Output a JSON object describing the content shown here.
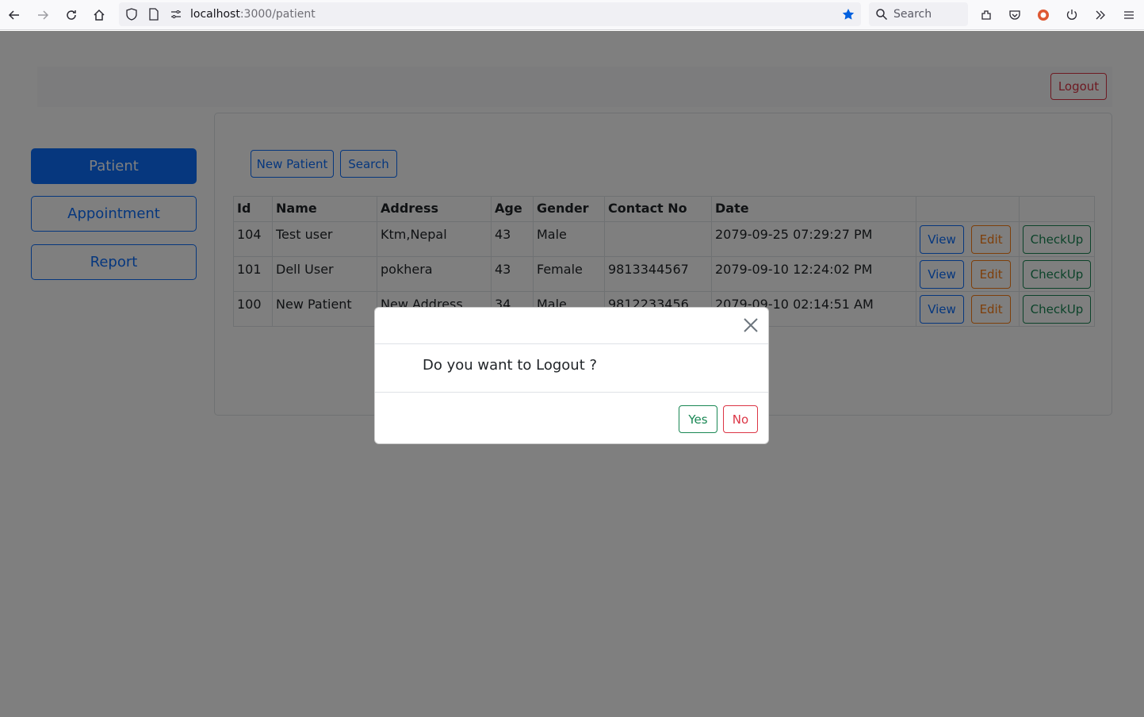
{
  "browser": {
    "url_host": "localhost",
    "url_path": ":3000/patient",
    "search_label": "Search"
  },
  "header": {
    "logout_label": "Logout"
  },
  "sidebar": {
    "items": [
      {
        "label": "Patient",
        "active": true
      },
      {
        "label": "Appointment",
        "active": false
      },
      {
        "label": "Report",
        "active": false
      }
    ]
  },
  "toolbar": {
    "new_patient_label": "New Patient",
    "search_label": "Search"
  },
  "table": {
    "headers": [
      "Id",
      "Name",
      "Address",
      "Age",
      "Gender",
      "Contact No",
      "Date"
    ],
    "rows": [
      {
        "id": "104",
        "name": "Test user",
        "address": "Ktm,Nepal",
        "age": "43",
        "gender": "Male",
        "contact": "",
        "date": "2079-09-25 07:29:27 PM"
      },
      {
        "id": "101",
        "name": "Dell User",
        "address": "pokhera",
        "age": "43",
        "gender": "Female",
        "contact": "9813344567",
        "date": "2079-09-10 12:24:02 PM"
      },
      {
        "id": "100",
        "name": "New Patient",
        "address": "New Address",
        "age": "34",
        "gender": "Male",
        "contact": "9812233456",
        "date": "2079-09-10 02:14:51 AM"
      }
    ],
    "actions": {
      "view_label": "View",
      "edit_label": "Edit",
      "checkup_label": "CheckUp"
    }
  },
  "modal": {
    "message": "Do you want to Logout ?",
    "yes_label": "Yes",
    "no_label": "No"
  },
  "colors": {
    "primary": "#0d6efd",
    "danger": "#dc3545",
    "warning": "#fd7e14",
    "success": "#198754"
  }
}
